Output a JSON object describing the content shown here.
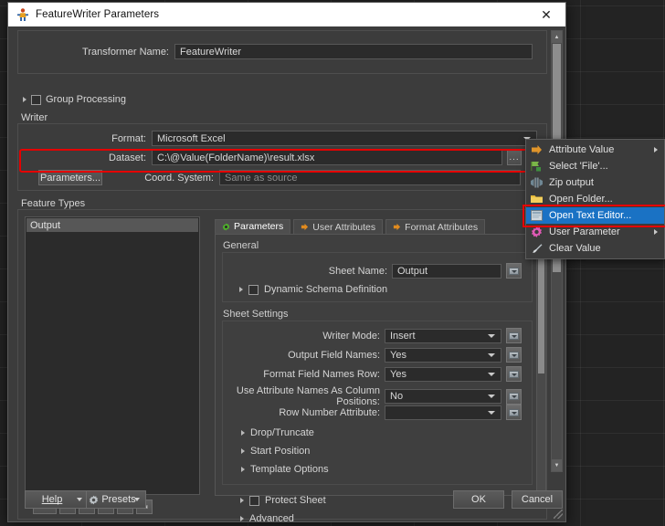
{
  "window": {
    "title": "FeatureWriter Parameters",
    "icon": "fme-transformer-icon",
    "close_label": "✕"
  },
  "transformer": {
    "name_label": "Transformer Name:",
    "name_value": "FeatureWriter"
  },
  "group_processing": {
    "label": "Group Processing",
    "checked": false
  },
  "writer": {
    "caption": "Writer",
    "format_label": "Format:",
    "format_value": "Microsoft Excel",
    "dataset_label": "Dataset:",
    "dataset_value": "C:\\@Value(FolderName)\\result.xlsx",
    "browse_label": "...",
    "parameters_button": "Parameters...",
    "coord_label": "Coord. System:",
    "coord_placeholder": "Same as source"
  },
  "feature_types": {
    "caption": "Feature Types",
    "items": [
      {
        "label": "Output",
        "selected": true
      }
    ],
    "toolbar": [
      {
        "name": "add-feature-type-button",
        "glyph": "+",
        "has_caret": true
      },
      {
        "name": "remove-feature-type-button",
        "glyph": "−",
        "has_caret": false
      },
      {
        "name": "move-up-button",
        "glyph": "▲",
        "has_caret": false
      },
      {
        "name": "move-down-button",
        "glyph": "▼",
        "has_caret": false
      },
      {
        "name": "move-to-top-button",
        "glyph": "⤒",
        "has_caret": false
      },
      {
        "name": "move-to-bottom-button",
        "glyph": "⤓",
        "has_caret": false
      }
    ]
  },
  "tabs": [
    {
      "label": "Parameters",
      "icon": "gear-icon",
      "active": true
    },
    {
      "label": "User Attributes",
      "icon": "orange-arrow-icon",
      "active": false
    },
    {
      "label": "Format Attributes",
      "icon": "orange-arrow-icon",
      "active": false
    }
  ],
  "parameters_tab": {
    "general": {
      "caption": "General",
      "sheet_name_label": "Sheet Name:",
      "sheet_name_value": "Output",
      "dynamic_schema_label": "Dynamic Schema Definition",
      "dynamic_schema_checked": false
    },
    "sheet_settings": {
      "caption": "Sheet Settings",
      "rows": [
        {
          "label": "Writer Mode:",
          "value": "Insert"
        },
        {
          "label": "Output Field Names:",
          "value": "Yes"
        },
        {
          "label": "Format Field Names Row:",
          "value": "Yes"
        },
        {
          "label": "Use Attribute Names As Column Positions:",
          "value": "No"
        },
        {
          "label": "Row Number Attribute:",
          "value": ""
        }
      ]
    },
    "sections": [
      {
        "label": "Drop/Truncate",
        "has_checkbox": false
      },
      {
        "label": "Start Position",
        "has_checkbox": false
      },
      {
        "label": "Template Options",
        "has_checkbox": false
      },
      {
        "label": "Protect Sheet",
        "has_checkbox": true
      },
      {
        "label": "Advanced",
        "has_checkbox": false
      }
    ]
  },
  "footer": {
    "help_label": "Help",
    "presets_label": "Presets",
    "ok_label": "OK",
    "cancel_label": "Cancel"
  },
  "context_menu": {
    "items": [
      {
        "label": "Attribute Value",
        "icon": "orange-arrow-icon",
        "submenu": true,
        "selected": false
      },
      {
        "label": "Select 'File'...",
        "icon": "green-flag-icon",
        "submenu": false,
        "selected": false
      },
      {
        "label": "Zip output",
        "icon": "zip-icon",
        "submenu": false,
        "selected": false
      },
      {
        "label": "Open Folder...",
        "icon": "yellow-folder-icon",
        "submenu": false,
        "selected": false
      },
      {
        "label": "Open Text Editor...",
        "icon": "text-editor-icon",
        "submenu": false,
        "selected": true
      },
      {
        "label": "User Parameter",
        "icon": "magenta-gear-icon",
        "submenu": true,
        "selected": false
      },
      {
        "label": "Clear Value",
        "icon": "brush-icon",
        "submenu": false,
        "selected": false
      }
    ]
  },
  "annotations": {
    "accent_red": "#e50000",
    "highlight_blue": "#1a72c4"
  }
}
